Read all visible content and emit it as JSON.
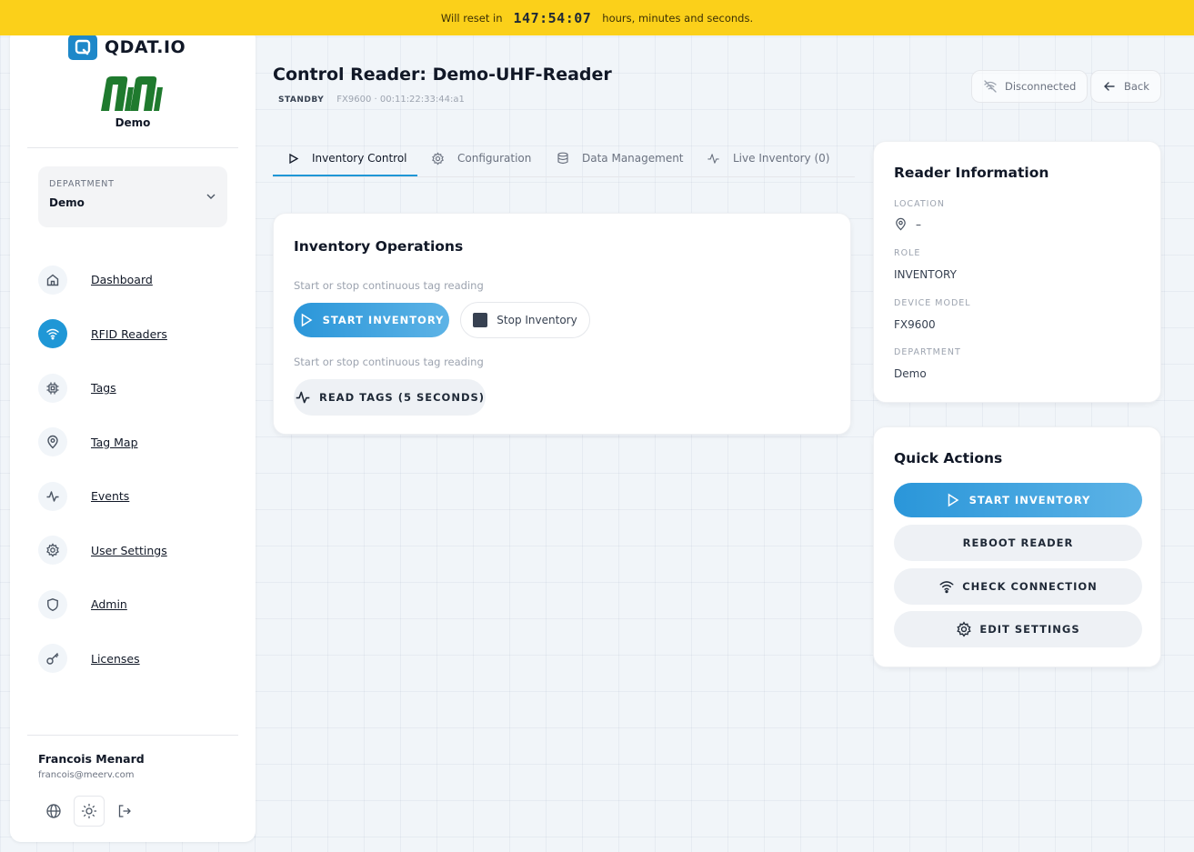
{
  "banner": {
    "prefix": "Will reset in",
    "timer": "147:54:07",
    "suffix": "hours, minutes and seconds."
  },
  "brand": {
    "name": "QDAT.IO",
    "tenant_name": "Demo"
  },
  "department": {
    "label": "DEPARTMENT",
    "value": "Demo"
  },
  "nav": [
    {
      "label": "Dashboard",
      "icon": "home-icon",
      "active": false
    },
    {
      "label": "RFID Readers",
      "icon": "wifi-icon",
      "active": true
    },
    {
      "label": "Tags",
      "icon": "chip-icon",
      "active": false
    },
    {
      "label": "Tag Map",
      "icon": "map-pin-icon",
      "active": false
    },
    {
      "label": "Events",
      "icon": "activity-icon",
      "active": false
    },
    {
      "label": "User Settings",
      "icon": "gear-icon",
      "active": false
    },
    {
      "label": "Admin",
      "icon": "shield-icon",
      "active": false
    },
    {
      "label": "Licenses",
      "icon": "key-icon",
      "active": false
    }
  ],
  "user": {
    "name": "Francois Menard",
    "email": "francois@meerv.com"
  },
  "header": {
    "title": "Control Reader: Demo-UHF-Reader",
    "status": "STANDBY",
    "meta": "FX9600 · 00:11:22:33:44:a1",
    "connection": "Disconnected",
    "back": "Back"
  },
  "tabs": [
    {
      "label": "Inventory Control",
      "icon": "play-icon",
      "active": true
    },
    {
      "label": "Configuration",
      "icon": "gear-icon",
      "active": false
    },
    {
      "label": "Data Management",
      "icon": "database-icon",
      "active": false
    },
    {
      "label": "Live Inventory (0)",
      "icon": "activity-icon",
      "active": false
    }
  ],
  "operations": {
    "title": "Inventory Operations",
    "hint1": "Start or stop continuous tag reading",
    "start": "START INVENTORY",
    "stop": "Stop Inventory",
    "hint2": "Start or stop continuous tag reading",
    "read": "READ TAGS (5 SECONDS)"
  },
  "reader_info": {
    "title": "Reader Information",
    "location_label": "LOCATION",
    "location_value": "–",
    "role_label": "ROLE",
    "role_value": "INVENTORY",
    "model_label": "DEVICE MODEL",
    "model_value": "FX9600",
    "dept_label": "DEPARTMENT",
    "dept_value": "Demo"
  },
  "quick_actions": {
    "title": "Quick Actions",
    "start": "START INVENTORY",
    "reboot": "REBOOT READER",
    "check": "CHECK CONNECTION",
    "edit": "EDIT SETTINGS"
  },
  "colors": {
    "banner": "#fbd01a",
    "accent": "#1f97d6",
    "brand": "#1e88c9",
    "tenant_logo": "#1f7a2e"
  }
}
